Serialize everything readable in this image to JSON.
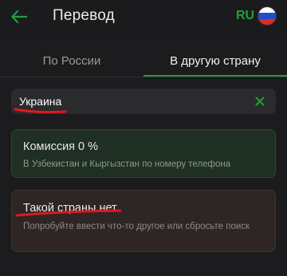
{
  "header": {
    "back_icon": "arrow-left-icon",
    "title": "Перевод",
    "lang": "RU",
    "flag_icon": "russia-flag-icon"
  },
  "tabs": [
    {
      "label": "По России",
      "active": false
    },
    {
      "label": "В другую страну",
      "active": true
    }
  ],
  "search": {
    "value": "Украина",
    "clear_icon": "close-icon"
  },
  "promo_card": {
    "title": "Комиссия 0 %",
    "text": "В Узбекистан и Кыргызстан по номеру телефона"
  },
  "empty_card": {
    "title": "Такой страны нет",
    "text": "Попробуйте ввести что-то другое или сбросьте поиск"
  },
  "colors": {
    "accent": "#21a038",
    "annotation": "#e0191f"
  }
}
